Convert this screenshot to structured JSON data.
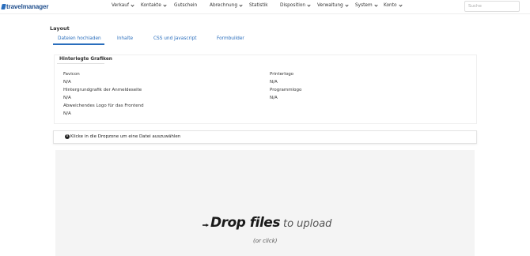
{
  "app": {
    "logo_text": "travelmanager"
  },
  "nav": {
    "items": [
      {
        "label": "Verkauf",
        "dropdown": true
      },
      {
        "label": "Kontakte",
        "dropdown": true
      },
      {
        "label": "Gutschein",
        "dropdown": false
      },
      {
        "label": "Abrechnung",
        "dropdown": true
      },
      {
        "label": "Statistik",
        "dropdown": false
      },
      {
        "label": "Disposition",
        "dropdown": true
      },
      {
        "label": "Verwaltung",
        "dropdown": true
      },
      {
        "label": "System",
        "dropdown": true
      },
      {
        "label": "Konto",
        "dropdown": true
      }
    ],
    "search_placeholder": "Suche"
  },
  "page": {
    "title": "Layout",
    "tabs": [
      {
        "label": "Dateien hochladen",
        "active": true
      },
      {
        "label": "Inhalte",
        "active": false
      },
      {
        "label": "CSS und Javascript",
        "active": false
      },
      {
        "label": "Formbuilder",
        "active": false
      }
    ]
  },
  "panel": {
    "title": "Hinterlegte Grafiken",
    "left": [
      {
        "label": "Favicon",
        "value": "N/A"
      },
      {
        "label": "Hintergrundgrafik der Anmeldeseite",
        "value": "N/A"
      },
      {
        "label": "Abweichendes Logo für das Frontend",
        "value": "N/A"
      }
    ],
    "right": [
      {
        "label": "Printerlogo",
        "value": "N/A"
      },
      {
        "label": "Programmlogo",
        "value": "N/A"
      }
    ]
  },
  "info": {
    "text": "Klicke in die Dropzone um eine Datei auszuwählen"
  },
  "dropzone": {
    "main_bold": "Drop files",
    "main_light": "to upload",
    "sub": "(or click)"
  },
  "colors": {
    "accent": "#2a6ebd",
    "dropzone_bg": "#f4f4f4"
  }
}
